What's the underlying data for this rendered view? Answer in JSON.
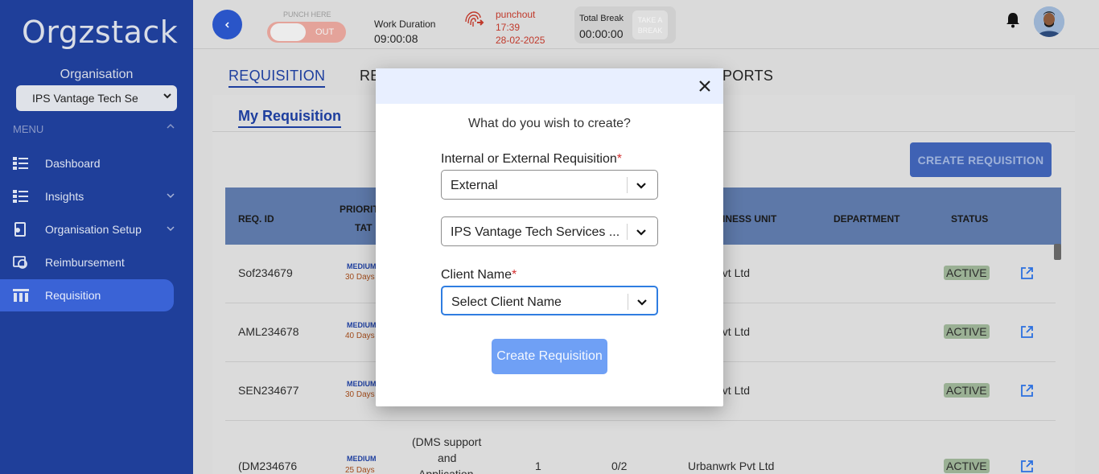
{
  "sidebar": {
    "logo": "Orgzstack",
    "org_label": "Organisation",
    "org_selected": "IPS Vantage Tech Se",
    "menu_label": "MENU",
    "items": [
      {
        "label": "Dashboard",
        "icon": "dashboard-icon",
        "has_chevron": false,
        "active": false
      },
      {
        "label": "Insights",
        "icon": "insights-icon",
        "has_chevron": true,
        "active": false
      },
      {
        "label": "Organisation Setup",
        "icon": "organisation-setup-icon",
        "has_chevron": true,
        "active": false
      },
      {
        "label": "Reimbursement",
        "icon": "reimbursement-icon",
        "has_chevron": false,
        "active": false
      },
      {
        "label": "Requisition",
        "icon": "requisition-icon",
        "has_chevron": false,
        "active": true
      }
    ]
  },
  "topbar": {
    "punch_here": "PUNCH HERE",
    "punch_toggle": "OUT",
    "work_duration_label": "Work Duration",
    "work_duration_value": "09:00:08",
    "punchout_label": "punchout",
    "punchout_time": "17:39",
    "punchout_date": "28-02-2025",
    "total_break_label": "Total Break",
    "total_break_value": "00:00:00",
    "take_break_line1": "TAKE A",
    "take_break_line2": "BREAK"
  },
  "main": {
    "tabs": [
      "REQUISITION",
      "RE",
      "PORTS"
    ],
    "subtab": "My Requisition",
    "create_button": "CREATE REQUISITION",
    "table": {
      "headers": {
        "req_id": "REQ. ID",
        "priority": "PRIORIT",
        "tat": "TAT",
        "business_unit": "INESS UNIT",
        "department": "DEPARTMENT",
        "status": "STATUS"
      },
      "rows": [
        {
          "id": "Sof234679",
          "priority": "MEDIUM",
          "days": "30 Days",
          "bu": "nwrk Pvt Ltd",
          "status": "ACTIVE"
        },
        {
          "id": "AML234678",
          "priority": "MEDIUM",
          "days": "40 Days",
          "bu": "nwrk Pvt Ltd",
          "status": "ACTIVE"
        },
        {
          "id": "SEN234677",
          "priority": "MEDIUM",
          "days": "30 Days",
          "bu": "nwrk Pvt Ltd",
          "status": "ACTIVE"
        },
        {
          "id": "(DM234676",
          "priority": "MEDIUM",
          "days": "25 Days",
          "title_line1": "(DMS support",
          "title_line2": "and",
          "title_line3": "Application",
          "col_a": "1",
          "col_b": "0/2",
          "bu": "Urbanwrk Pvt Ltd",
          "status": "ACTIVE"
        }
      ]
    }
  },
  "modal": {
    "question": "What do you wish to create?",
    "type_label": "Internal or External Requisition",
    "type_value": "External",
    "org_value": "IPS Vantage Tech Services ...",
    "client_label": "Client Name",
    "client_placeholder": "Select Client Name",
    "required_mark": "*",
    "submit": "Create Requisition"
  }
}
